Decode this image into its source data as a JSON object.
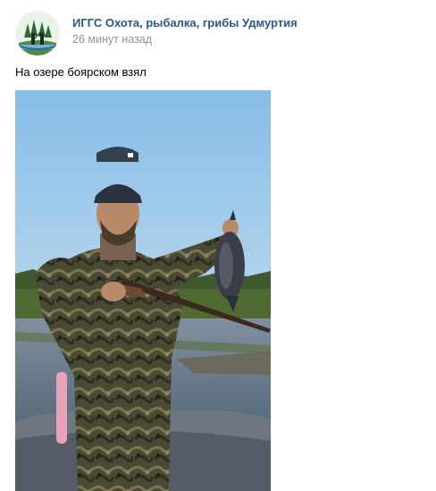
{
  "post": {
    "group_name": "ИГГС Охота, рыбалка, грибы Удмуртия",
    "timestamp": "26 минут назад",
    "text": "На озере боярском взял"
  },
  "icons": {
    "avatar": "group-logo-hunters-icon"
  },
  "colors": {
    "link": "#2a5885",
    "meta": "#939393",
    "text": "#000000",
    "background": "#ffffff"
  }
}
